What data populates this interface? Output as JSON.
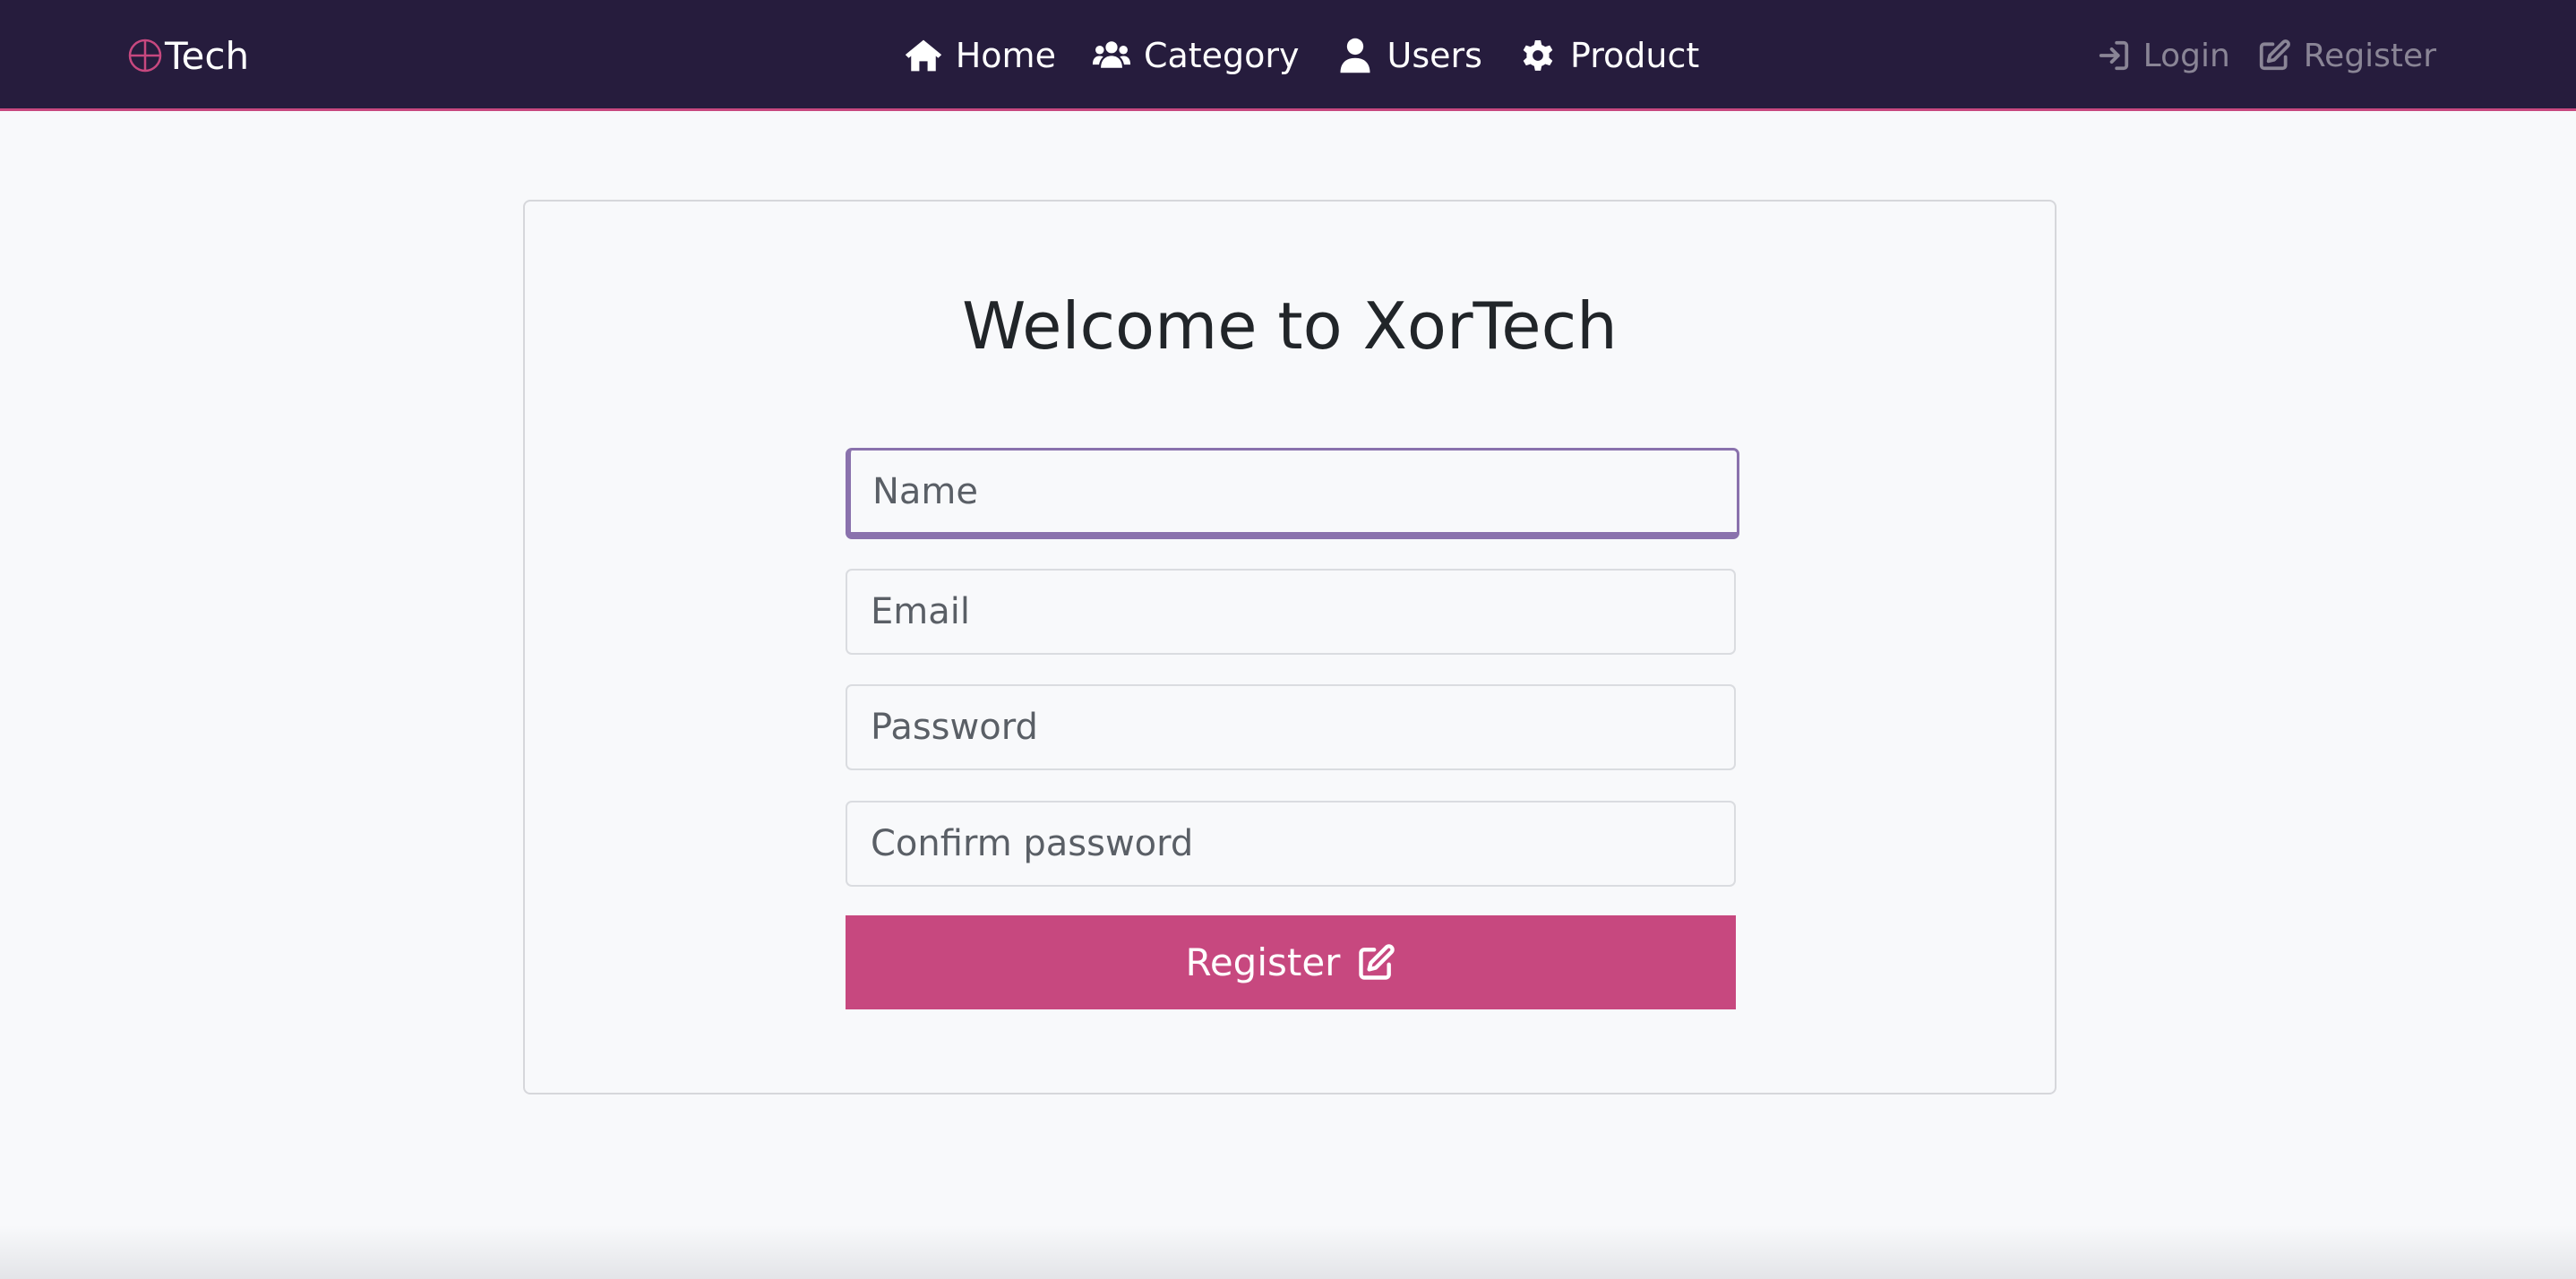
{
  "brand": {
    "text": "Tech",
    "logo_color": "#c7487f"
  },
  "nav": {
    "items": [
      {
        "label": "Home",
        "icon": "home-icon"
      },
      {
        "label": "Category",
        "icon": "users-group-icon"
      },
      {
        "label": "Users",
        "icon": "user-icon"
      },
      {
        "label": "Product",
        "icon": "gear-icon"
      }
    ],
    "auth": [
      {
        "label": "Login",
        "icon": "sign-in-icon"
      },
      {
        "label": "Register",
        "icon": "edit-icon"
      }
    ]
  },
  "form": {
    "title": "Welcome to XorTech",
    "fields": [
      {
        "placeholder": "Name",
        "value": ""
      },
      {
        "placeholder": "Email",
        "value": ""
      },
      {
        "placeholder": "Password",
        "value": ""
      },
      {
        "placeholder": "Confirm password",
        "value": ""
      }
    ],
    "submit_label": "Register",
    "submit_icon": "edit-icon"
  },
  "colors": {
    "navbar_bg": "#261c3d",
    "accent": "#c7487f",
    "focus_border": "#8a72ad",
    "page_bg": "#f8f9fb"
  }
}
